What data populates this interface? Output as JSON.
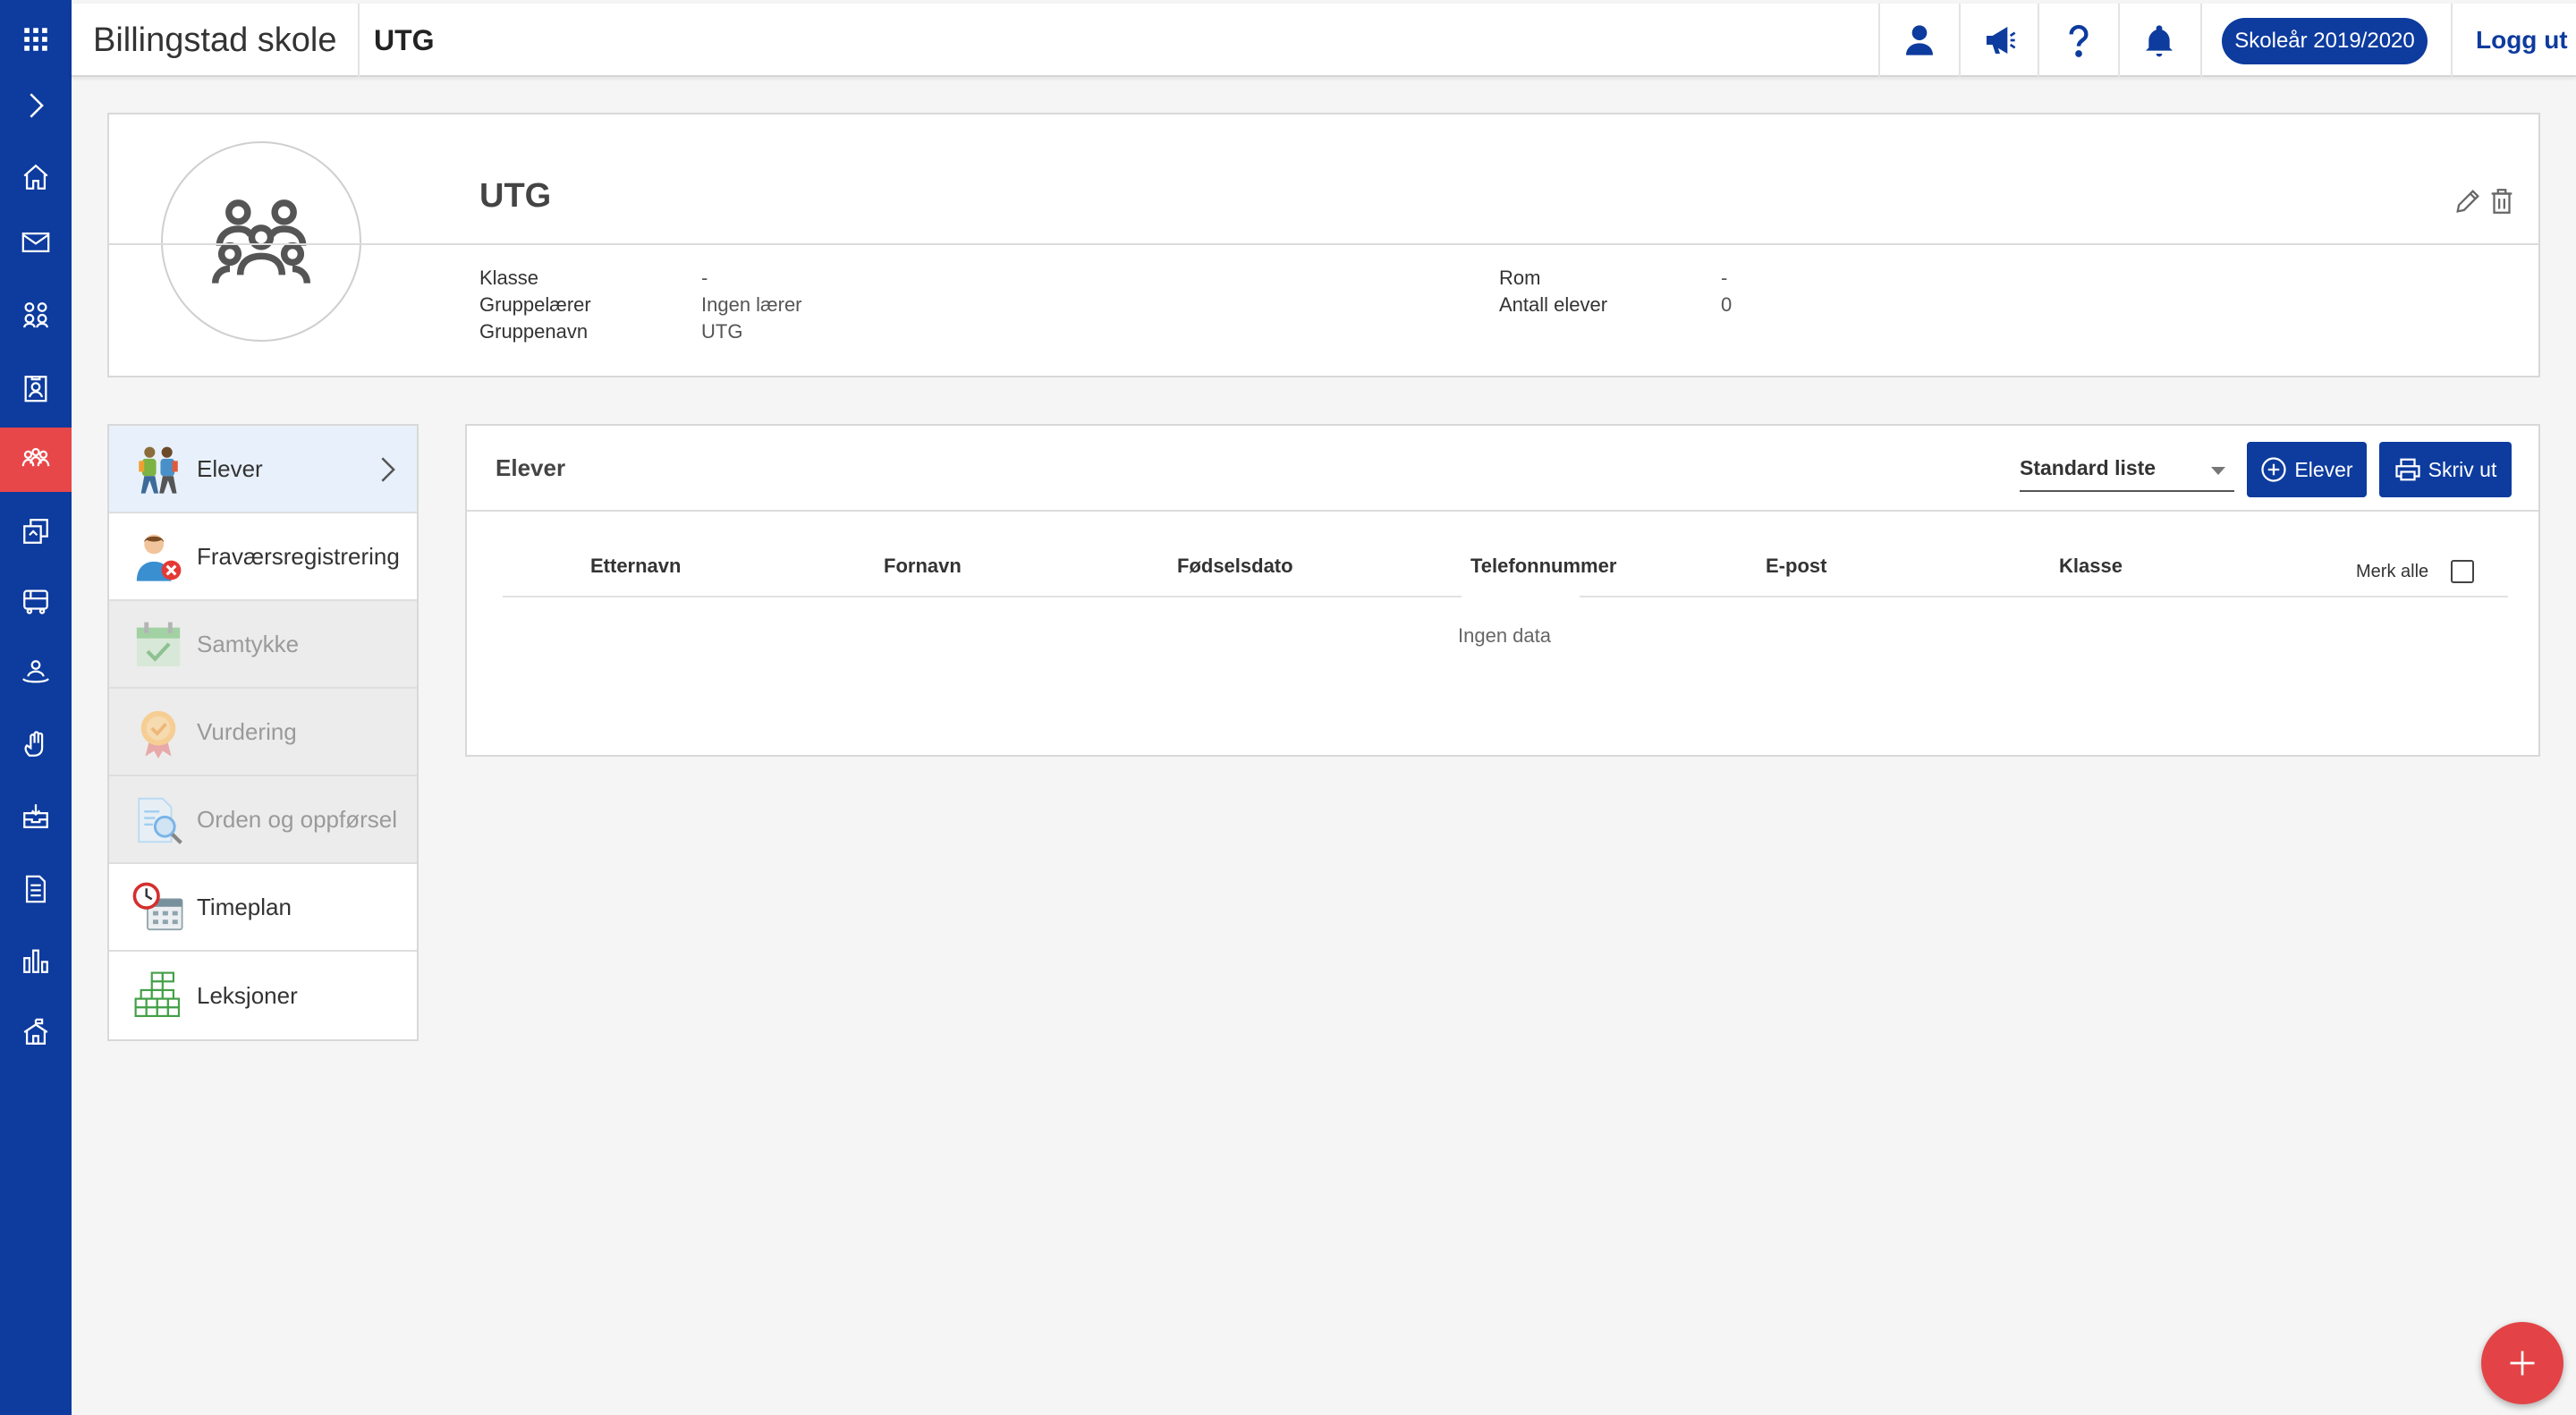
{
  "app": {
    "school_name": "Billingstad skole",
    "group_code": "UTG",
    "school_year": "Skoleår 2019/2020",
    "logout": "Logg ut"
  },
  "colors": {
    "brand": "#0d3b9e",
    "active_nav": "#e8474a",
    "fab": "#e34346"
  },
  "rail": {
    "items": [
      {
        "icon": "apps-grid-icon",
        "active": false
      },
      {
        "icon": "expand-chevron-icon",
        "active": false
      },
      {
        "icon": "home-icon",
        "active": false
      },
      {
        "icon": "mail-icon",
        "active": false
      },
      {
        "icon": "people-icon",
        "active": false
      },
      {
        "icon": "id-badge-icon",
        "active": false
      },
      {
        "icon": "groups-icon",
        "active": true
      },
      {
        "icon": "transfer-icon",
        "active": false
      },
      {
        "icon": "bus-icon",
        "active": false
      },
      {
        "icon": "support-icon",
        "active": false
      },
      {
        "icon": "hand-icon",
        "active": false
      },
      {
        "icon": "inbox-icon",
        "active": false
      },
      {
        "icon": "document-icon",
        "active": false
      },
      {
        "icon": "bar-chart-icon",
        "active": false
      },
      {
        "icon": "school-icon",
        "active": false
      }
    ]
  },
  "topbar_icons": [
    "user-icon",
    "megaphone-icon",
    "help-icon",
    "bell-icon"
  ],
  "group": {
    "title": "UTG",
    "fields": [
      {
        "label": "Klasse",
        "value": "-"
      },
      {
        "label": "Gruppelærer",
        "value": "Ingen lærer"
      },
      {
        "label": "Gruppenavn",
        "value": "UTG"
      }
    ],
    "fields_right": [
      {
        "label": "Rom",
        "value": "-"
      },
      {
        "label": "Antall elever",
        "value": "0"
      }
    ]
  },
  "menu": {
    "items": [
      {
        "label": "Elever",
        "icon": "students-icon",
        "state": "active"
      },
      {
        "label": "Fraværsregistrering",
        "icon": "absence-icon",
        "state": "normal"
      },
      {
        "label": "Samtykke",
        "icon": "consent-calendar-icon",
        "state": "disabled"
      },
      {
        "label": "Vurdering",
        "icon": "rating-medal-icon",
        "state": "disabled"
      },
      {
        "label": "Orden og oppførsel",
        "icon": "conduct-search-icon",
        "state": "disabled"
      },
      {
        "label": "Timeplan",
        "icon": "schedule-icon",
        "state": "normal"
      },
      {
        "label": "Leksjoner",
        "icon": "lessons-grid-icon",
        "state": "normal"
      }
    ]
  },
  "students": {
    "title": "Elever",
    "list_select": "Standard liste",
    "add_button": "Elever",
    "print_button": "Skriv ut",
    "columns": [
      "Etternavn",
      "Fornavn",
      "Fødselsdato",
      "Telefonnummer",
      "E-post",
      "Klasse"
    ],
    "select_all": "Merk alle",
    "empty": "Ingen data"
  }
}
